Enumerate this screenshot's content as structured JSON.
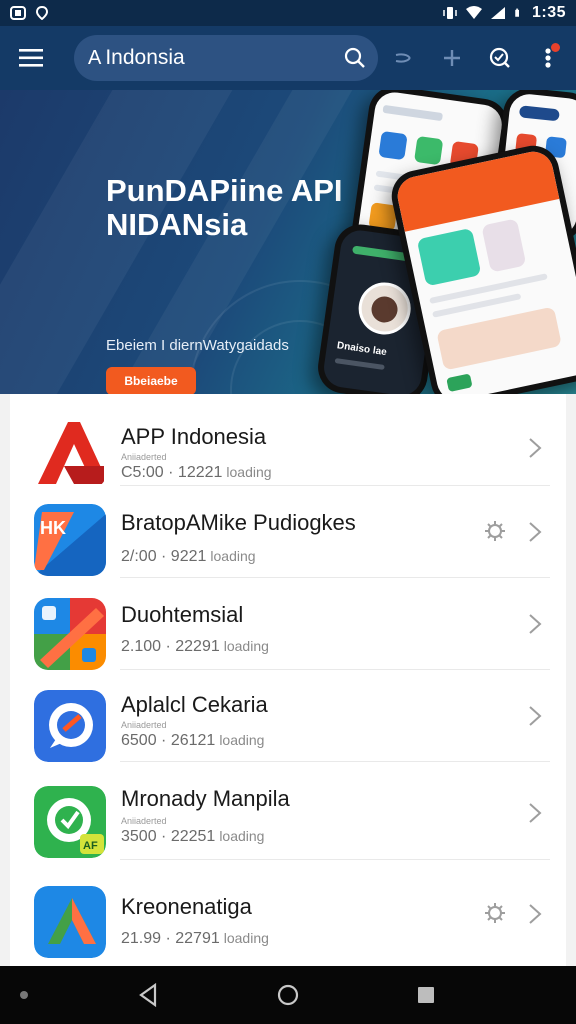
{
  "status_bar": {
    "time": "1:35",
    "left_icons": [
      "notification-icon",
      "location-icon"
    ],
    "right_icons": [
      "vibrate-icon",
      "wifi-icon",
      "signal-icon",
      "battery-icon"
    ]
  },
  "toolbar": {
    "menu_icon": "hamburger-icon",
    "title_mark": "A",
    "title": "Indonsia",
    "icons": [
      "search-icon",
      "share-icon",
      "add-icon",
      "refresh-icon",
      "more-vert-icon"
    ],
    "badge_color": "#e8412c"
  },
  "banner": {
    "title_line1": "PunDAPiine API",
    "title_line2": "NIDANsia",
    "subtitle": "Ebeiem I diernWatygaidads",
    "button_label": "Bbeiaebe",
    "phone_text": "Dnaiso lae",
    "accent_color": "#f25a1f"
  },
  "apps": [
    {
      "name": "APP Indonesia",
      "small": "Aniiaderted",
      "meta": "C5:00 · 12221",
      "status": "loading",
      "has_gear": false,
      "icon": "red-a-logo-icon"
    },
    {
      "name": "BratopAMike Pudiogkes",
      "small": "",
      "meta": "2/:00 · 9221",
      "status": "loading",
      "has_gear": true,
      "icon": "blue-hk-logo-icon"
    },
    {
      "name": "Duohtemsial",
      "small": "",
      "meta": "2.100 · 22291",
      "status": "loading",
      "has_gear": false,
      "icon": "multicolor-tiles-icon"
    },
    {
      "name": "Aplalcl Cekaria",
      "small": "Aniiaderted",
      "meta": "6500 · 26121",
      "status": "loading",
      "has_gear": false,
      "icon": "blue-chat-bubble-icon"
    },
    {
      "name": "Mronady Manpila",
      "small": "Aniiaderted",
      "meta": "3500 · 22251",
      "status": "loading",
      "has_gear": false,
      "icon": "green-chat-icon"
    },
    {
      "name": "Kreonenatiga",
      "small": "",
      "meta": "21.99 · 22791",
      "status": "loading",
      "has_gear": true,
      "icon": "blue-arrow-logo-icon"
    }
  ],
  "navbar": {
    "icons": [
      "dot-icon",
      "back-icon",
      "home-icon",
      "recents-icon"
    ]
  }
}
